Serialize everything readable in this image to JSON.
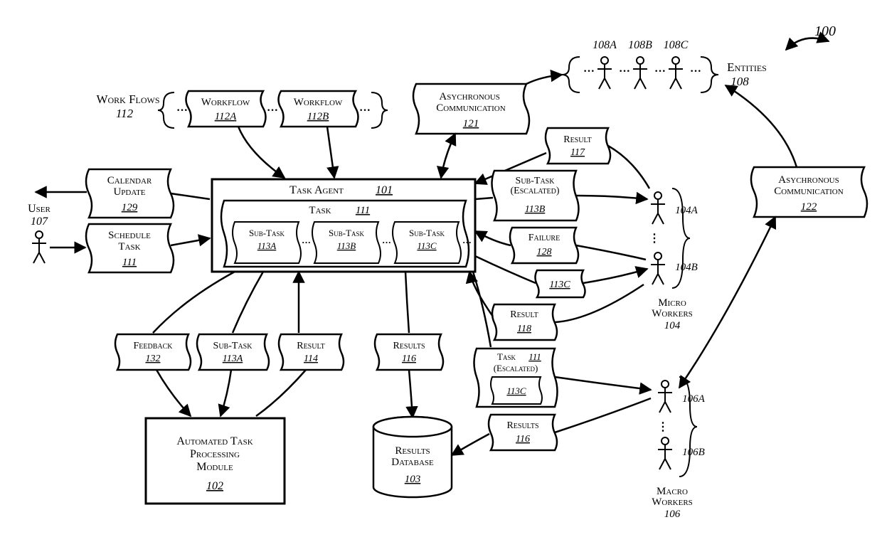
{
  "figure_ref": {
    "number": "100"
  },
  "workflows": {
    "group_label": "Work Flows",
    "group_num": "112",
    "a": {
      "label": "Workflow",
      "num": "112A"
    },
    "b": {
      "label": "Workflow",
      "num": "112B"
    }
  },
  "async_comm_1": {
    "label": "Asychronous Communication",
    "num": "121"
  },
  "async_comm_2": {
    "label": "Asychronous Communication",
    "num": "122"
  },
  "entities": {
    "group_label": "Entities",
    "group_num": "108",
    "a": "108A",
    "b": "108B",
    "c": "108C"
  },
  "user": {
    "label": "User",
    "num": "107"
  },
  "calendar_update": {
    "label": "Calendar Update",
    "num": "129"
  },
  "schedule_task": {
    "label": "Schedule Task",
    "num": "111"
  },
  "task_agent": {
    "label": "Task Agent",
    "num": "101",
    "task": {
      "label": "Task",
      "num": "111"
    },
    "sub_a": {
      "label": "Sub-Task",
      "num": "113A"
    },
    "sub_b": {
      "label": "Sub-Task",
      "num": "113B"
    },
    "sub_c": {
      "label": "Sub-Task",
      "num": "113C"
    }
  },
  "result_117": {
    "label": "Result",
    "num": "117"
  },
  "subtask_escalated": {
    "label1": "Sub-Task",
    "label2": "(Escalated)",
    "num": "113B"
  },
  "failure": {
    "label": "Failure",
    "num": "128"
  },
  "bare_113c": {
    "num": "113C"
  },
  "result_118": {
    "label": "Result",
    "num": "118"
  },
  "feedback": {
    "label": "Feedback",
    "num": "132"
  },
  "subtask_113a": {
    "label": "Sub-Task",
    "num": "113A"
  },
  "result_114": {
    "label": "Result",
    "num": "114"
  },
  "results_116a": {
    "label": "Results",
    "num": "116"
  },
  "task_escalated": {
    "label1": "Task",
    "num1": "111",
    "label2": "(Escalated)",
    "inner_num": "113C"
  },
  "results_116b": {
    "label": "Results",
    "num": "116"
  },
  "automated_module": {
    "label1": "Automated Task",
    "label2": "Processing",
    "label3": "Module",
    "num": "102"
  },
  "results_db": {
    "label1": "Results",
    "label2": "Database",
    "num": "103"
  },
  "micro_workers": {
    "label1": "Micro",
    "label2": "Workers",
    "num": "104",
    "a": "104A",
    "b": "104B"
  },
  "macro_workers": {
    "label1": "Macro",
    "label2": "Workers",
    "num": "106",
    "a": "106A",
    "b": "106B"
  }
}
